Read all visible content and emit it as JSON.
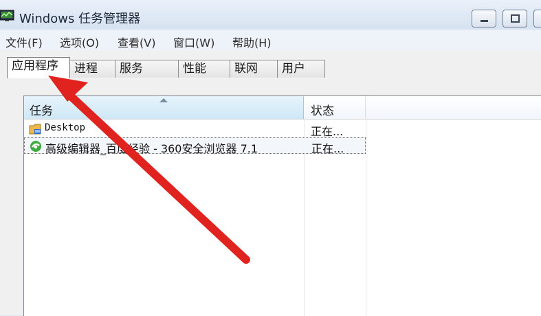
{
  "window": {
    "title": "Windows 任务管理器"
  },
  "menu": [
    "文件(F)",
    "选项(O)",
    "查看(V)",
    "窗口(W)",
    "帮助(H)"
  ],
  "tabs": [
    {
      "label": "应用程序",
      "active": true
    },
    {
      "label": "进程",
      "active": false
    },
    {
      "label": "服务",
      "active": false
    },
    {
      "label": "性能",
      "active": false
    },
    {
      "label": "联网",
      "active": false
    },
    {
      "label": "用户",
      "active": false
    }
  ],
  "table": {
    "columns": [
      "任务",
      "状态"
    ],
    "rows": [
      {
        "icon": "folder-icon",
        "task": "Desktop",
        "status": "正在..."
      },
      {
        "icon": "browser-icon",
        "task": "高级编辑器_百度经验 - 360安全浏览器 7.1",
        "status": "正在...",
        "selected": true
      }
    ]
  },
  "colors": {
    "annotation_arrow": "#e0231f",
    "selected_header": "#cfe8f7"
  }
}
